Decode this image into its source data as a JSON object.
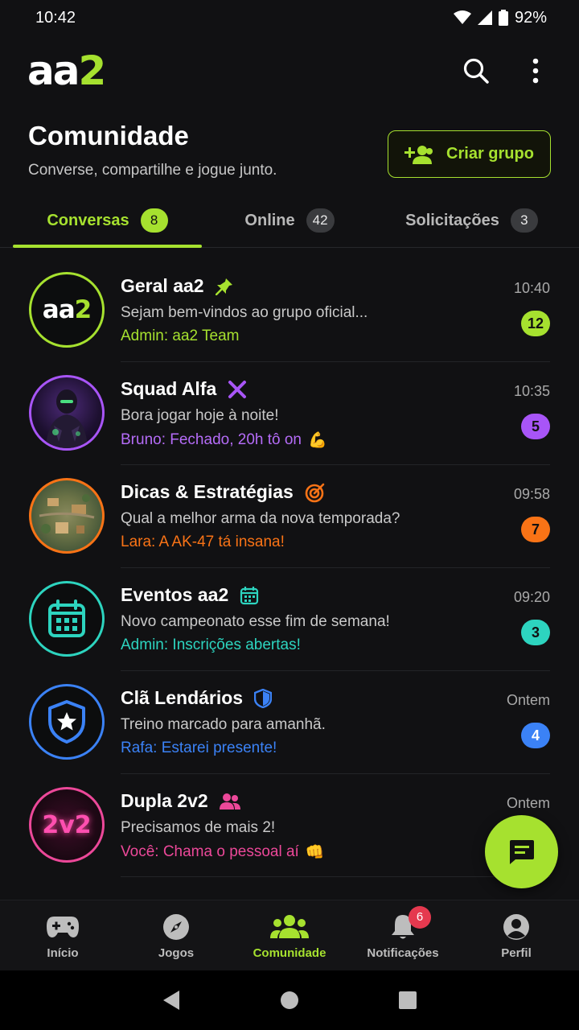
{
  "status": {
    "time": "10:42",
    "battery": "92%"
  },
  "app": {
    "logo_main": "aa",
    "logo_accent": "2"
  },
  "page": {
    "title": "Comunidade",
    "subtitle": "Converse, compartilhe e jogue junto.",
    "create_label": "Criar grupo"
  },
  "tabs": [
    {
      "label": "Conversas",
      "count": "8"
    },
    {
      "label": "Online",
      "count": "42"
    },
    {
      "label": "Solicitações",
      "count": "3"
    }
  ],
  "conversations": [
    {
      "name": "Geral aa2",
      "message": "Sejam bem-vindos ao grupo oficial...",
      "sub": "Admin: aa2 Team",
      "time": "10:40",
      "badge": "12",
      "avatar_text": "aa2",
      "color": "#a6e12f",
      "icon": "pin-icon"
    },
    {
      "name": "Squad Alfa",
      "message": "Bora jogar hoje à noite!",
      "sub": "Bruno: Fechado, 20h tô on",
      "time": "10:35",
      "badge": "5",
      "color": "#a855f7",
      "icon": "crossed-swords-icon",
      "emoji": "💪"
    },
    {
      "name": "Dicas & Estratégias",
      "message": "Qual a melhor arma da nova temporada?",
      "sub": "Lara: A AK-47 tá insana!",
      "time": "09:58",
      "badge": "7",
      "color": "#f97316",
      "icon": "target-icon"
    },
    {
      "name": "Eventos aa2",
      "message": "Novo campeonato esse fim de semana!",
      "sub": "Admin: Inscrições abertas!",
      "time": "09:20",
      "badge": "3",
      "color": "#2dd4bf",
      "icon": "calendar-icon"
    },
    {
      "name": "Clã Lendários",
      "message": "Treino marcado para amanhã.",
      "sub": "Rafa: Estarei presente!",
      "time": "Ontem",
      "badge": "4",
      "color": "#3b82f6",
      "icon": "shield-icon"
    },
    {
      "name": "Dupla 2v2",
      "message": "Precisamos de mais 2!",
      "sub": "Você: Chama o pessoal aí",
      "time": "Ontem",
      "avatar_text": "2v2",
      "color": "#ec4899",
      "icon": "users-icon",
      "emoji": "👊"
    }
  ],
  "nav": [
    {
      "label": "Início"
    },
    {
      "label": "Jogos"
    },
    {
      "label": "Comunidade"
    },
    {
      "label": "Notificações",
      "badge": "6"
    },
    {
      "label": "Perfil"
    }
  ]
}
